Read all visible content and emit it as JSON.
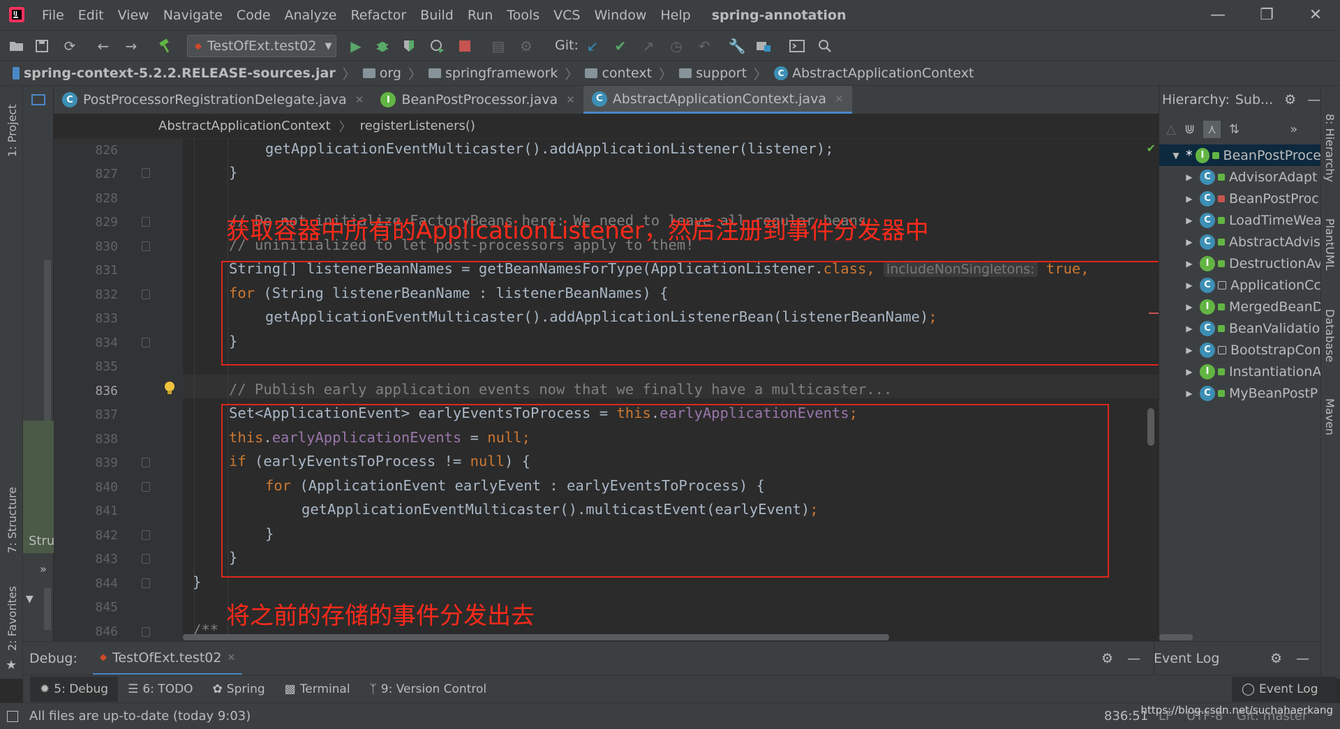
{
  "menubar": {
    "items": [
      "File",
      "Edit",
      "View",
      "Navigate",
      "Code",
      "Analyze",
      "Refactor",
      "Build",
      "Run",
      "Tools",
      "VCS",
      "Window",
      "Help"
    ],
    "project": "spring-annotation",
    "logo_icon": "intellij-logo-icon",
    "window_controls": [
      "minimize-icon",
      "restore-icon",
      "close-icon"
    ]
  },
  "toolbar": {
    "run_config": "TestOfExt.test02",
    "git_label": "Git:"
  },
  "navbar": {
    "jar": "spring-context-5.2.2.RELEASE-sources.jar",
    "crumbs": [
      "org",
      "springframework",
      "context",
      "support",
      "AbstractApplicationContext"
    ]
  },
  "left_strip": {
    "project_label": "1: Project",
    "structure_label": "7: Structure",
    "favorites_label": "2: Favorites",
    "stru_short": "Stru"
  },
  "tabs": [
    {
      "label": "PostProcessorRegistrationDelegate.java",
      "badge": "C",
      "active": false
    },
    {
      "label": "BeanPostProcessor.java",
      "badge": "I",
      "active": false
    },
    {
      "label": "AbstractApplicationContext.java",
      "badge": "C",
      "active": true
    }
  ],
  "editor_breadcrumb": {
    "class_name": "AbstractApplicationContext",
    "method": "registerListeners()"
  },
  "gutter": {
    "line_numbers": [
      "826",
      "827",
      "828",
      "829",
      "830",
      "831",
      "832",
      "833",
      "834",
      "835",
      "836",
      "837",
      "838",
      "839",
      "840",
      "841",
      "842",
      "843",
      "844",
      "845",
      "846"
    ],
    "current_line": "836"
  },
  "code": {
    "l826": "getApplicationEventMulticaster().addApplicationListener(listener);",
    "l827": "}",
    "l829": "// Do not initialize FactoryBeans here: We need to leave all regular beans",
    "l830": "// uninitialized to let post-processors apply to them!",
    "l831_a": "String[] listenerBeanNames = getBeanNamesForType(ApplicationListener.",
    "l831_kw": "class",
    "l831_b": ",",
    "l831_hint": "includeNonSingletons:",
    "l831_c": "true,",
    "l832_kw": "for",
    "l832_b": " (String listenerBeanName : listenerBeanNames) {",
    "l833": "getApplicationEventMulticaster().addApplicationListenerBean(listenerBeanName)",
    "l833_semi": ";",
    "l834": "}",
    "l836": "// Publish early application events now that we finally have a multicaster...",
    "l837_a": "Set<ApplicationEvent> earlyEventsToProcess = ",
    "l837_kw": "this",
    "l837_dot": ".",
    "l837_fld": "earlyApplicationEvents",
    "l837_semi": ";",
    "l838_kw": "this",
    "l838_dot": ".",
    "l838_fld": "earlyApplicationEvents",
    "l838_b": " = ",
    "l838_null": "null",
    "l838_semi": ";",
    "l839_kw": "if",
    "l839_b": " (earlyEventsToProcess != ",
    "l839_null": "null",
    "l839_c": ") {",
    "l840_kw": "for",
    "l840_b": " (ApplicationEvent earlyEvent : earlyEventsToProcess) {",
    "l841": "getApplicationEventMulticaster().multicastEvent(earlyEvent)",
    "l841_semi": ";",
    "l842": "}",
    "l843": "}",
    "l844": "}",
    "l846": "/**"
  },
  "annotations": {
    "top": "获取容器中所有的ApplicationListener，然后注册到事件分发器中",
    "bottom": "将之前的存储的事件分发出去"
  },
  "hierarchy": {
    "title": "Hierarchy:",
    "scope": "Sub...",
    "root": "BeanPostProce",
    "items": [
      {
        "label": "AdvisorAdapt",
        "badge": "C"
      },
      {
        "label": "BeanPostProc",
        "badge": "C"
      },
      {
        "label": "LoadTimeWea",
        "badge": "C"
      },
      {
        "label": "AbstractAdvis",
        "badge": "C"
      },
      {
        "label": "DestructionAv",
        "badge": "I"
      },
      {
        "label": "ApplicationCc",
        "badge": "C"
      },
      {
        "label": "MergedBeanD",
        "badge": "I"
      },
      {
        "label": "BeanValidatio",
        "badge": "C"
      },
      {
        "label": "BootstrapCon",
        "badge": "C"
      },
      {
        "label": "InstantiationA",
        "badge": "I"
      },
      {
        "label": "MyBeanPostP",
        "badge": "C"
      }
    ]
  },
  "right_strip": {
    "hierarchy": "8: Hierarchy",
    "plantuml": "PlantUML",
    "database": "Database",
    "maven": "Maven"
  },
  "debug": {
    "label": "Debug:",
    "session": "TestOfExt.test02",
    "event_log": "Event Log"
  },
  "tool_windows": [
    {
      "label": "5: Debug",
      "icon": "bug-icon",
      "active": true
    },
    {
      "label": "6: TODO",
      "icon": "list-icon",
      "active": false
    },
    {
      "label": "Spring",
      "icon": "spring-leaf-icon",
      "active": false
    },
    {
      "label": "Terminal",
      "icon": "terminal-icon",
      "active": false
    },
    {
      "label": "9: Version Control",
      "icon": "branch-icon",
      "active": false
    }
  ],
  "event_log_button": "Event Log",
  "status": {
    "message": "All files are up-to-date (today 9:03)",
    "position": "836:51",
    "line_sep": "LF",
    "encoding": "UTF-8",
    "git_branch": "Git: master",
    "watermark": "https://blog.csdn.net/suchahaerkang"
  },
  "colors": {
    "background": "#2b2b2b",
    "panel": "#3c3f41",
    "keyword": "#cc7832",
    "field": "#9876aa",
    "comment": "#808080",
    "annotation_red": "#ff2a1a",
    "accent": "#4a88c7"
  }
}
